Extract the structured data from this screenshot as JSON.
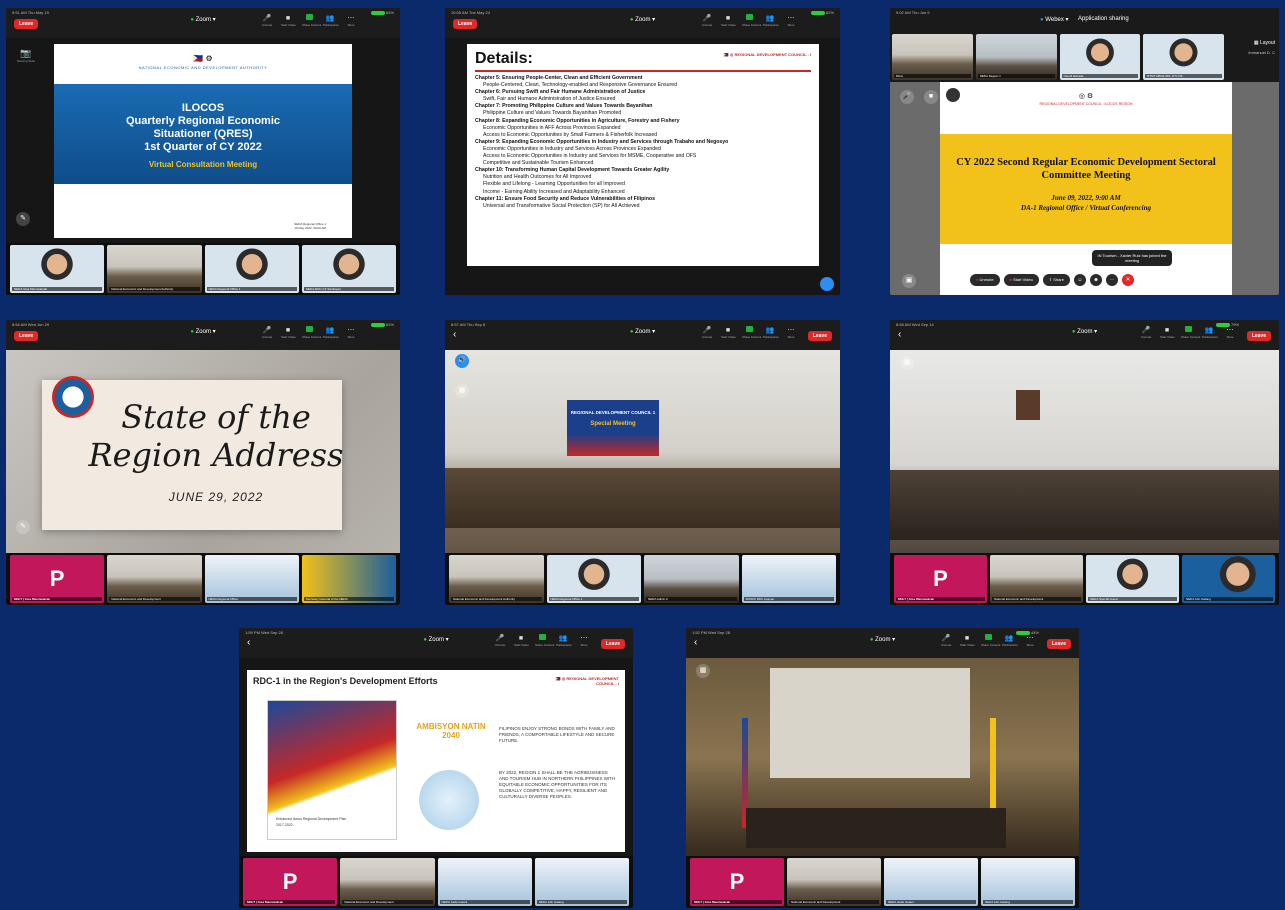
{
  "common": {
    "leave_label": "Leave",
    "zoom_title": "Zoom",
    "toolbar": [
      "Unmute",
      "Start Video",
      "Share Content",
      "Participants",
      "More"
    ]
  },
  "s1": {
    "time": "9:51 AM  Thu May 19",
    "battery": "64%",
    "photo_label": "Meeting Slide",
    "agency": "NATIONAL ECONOMIC AND DEVELOPMENT AUTHORITY",
    "title_lines": [
      "ILOCOS",
      "Quarterly Regional Economic",
      "Situationer (QRES)",
      "1st Quarter of CY 2022"
    ],
    "subtitle": "Virtual Consultation Meeting",
    "footer": [
      "NEDA Regional Office 1",
      "19 May 2022, 09:00 AM"
    ],
    "thumbs": [
      "NEDA Gisa Mannwakrab",
      "National Economic and Development Authority",
      "NEDA Regional Office 1",
      "NEDA-RDC-CF Santinyao"
    ]
  },
  "s2": {
    "time": "10:05 AM  Tue May 24",
    "battery": "62%",
    "heading": "Details:",
    "council": "REGIONAL DEVELOPMENT COUNCIL - I",
    "lines": [
      "Chapter 5: Ensuring People-Center, Clean and Efficient Government",
      "People-Centered, Clean, Technology-enabled and Responsive Governance Ensured",
      "Chapter 6: Pursuing Swift and Fair Humane Administration of Justice",
      "Swift, Fair and Humane Administration of Justice Ensured",
      "Chapter 7: Promoting Philippine Culture and Values Towards Bayanihan",
      "Philippine Culture and Values Towards Bayanihan Promoted",
      "Chapter 8: Expanding Economic Opportunities in Agriculture, Forestry and Fishery",
      "Economic Opportunities in AFF Across Provinces Expanded",
      "Access to Economic Opportunities by Small Farmers & Fisherfolk Increased",
      "Chapter 9: Expanding Economic Opportunities in Industry and Services through Trabaho and Negosyo",
      "Economic Opportunities in Industry and Services Across Provinces Expanded",
      "Access to Economic Opportunities in Industry and Services for MSME, Cooperative and OFS",
      "Competitive and Sustainable Tourism Enhanced",
      "Chapter 10: Transforming Human Capital Development Towards Greater Agility",
      "Nutrition and Health Outcomes for All Improved",
      "Flexible and Lifelong - Learning Opportunities for all Improved",
      "Income - Earning Ability Increased and Adaptability Enhanced",
      "Chapter 11: Ensure Food Security and Reduce Vulnerabilities of Filipinos",
      "Universal and Transformative Social Protection (SP) for All Achieved"
    ]
  },
  "s3": {
    "time": "9:02 AM  Thu Jun 9",
    "app": "Webex",
    "sharing": "Application sharing",
    "layout": "Layout",
    "people": [
      "DILG",
      "NEDA Region 1",
      "Cita M Estrada",
      "BTMT DBCE RPL DTI-VIS",
      "Immanuel D. C"
    ],
    "org_line": "REGIONAL DEVELOPMENT COUNCIL - ILOCOS REGION",
    "title": "CY 2022 Second Regular Economic Development Sectoral Committee Meeting",
    "date": "June 09, 2022, 9:00 AM",
    "venue": "DA-1 Regional Office / Virtual Conferencing",
    "toast": "IN Tourism - Xavier Ruiz has joined the meeting",
    "ctrl": [
      "Unmute",
      "Start Video",
      "Share"
    ]
  },
  "s4": {
    "time": "8:54 AM  Wed Jun 29",
    "battery": "61%",
    "title_lines": [
      "State of the",
      "Region Address"
    ],
    "date": "JUNE 29, 2022",
    "thumbs": [
      "MNLT | Gisa Mannwakrab",
      "National Economic and Development",
      "NEDA Regional Office",
      "Secretary General of the NEDA"
    ]
  },
  "s5": {
    "time": "8:57 AM  Thu Sep 8",
    "banner_title": "REGIONAL DEVELOPMENT COUNCIL 1",
    "banner_sub": "Special Meeting",
    "thumbs": [
      "National Economic and Development Authority",
      "NEDA Regional Office 1",
      "NEDA Admin 2",
      "SPRDC RDC Apayao"
    ]
  },
  "s6": {
    "time": "8:58 AM  Wed Sep 14",
    "battery": "79%",
    "thumbs": [
      "MNLT | Gisa Mannwakrab",
      "National Economic and Development",
      "NEDA Special Guest",
      "NEDA Lilin Galang"
    ]
  },
  "s7": {
    "time": "1:59 PM  Wed Sep 28",
    "battery": "80%",
    "heading": "RDC-1 in the Region's Development Efforts",
    "council": "REGIONAL DEVELOPMENT COUNCIL - I",
    "book_title": "Enhanced Ilocos Regional Development Plan",
    "book_years": "2017-2022",
    "ambisyon": "AMBISYON NATIN 2040",
    "para1": "FILIPINOS ENJOY STRONG BONDS WITH FAMILY AND FRIENDS, A COMFORTABLE LIFESTYLE AND SECURE FUTURE.",
    "para2": "BY 2022, REGION 1 SHALL BE THE AGRIBUSINESS AND TOURISM HUB IN NORTHERN PHILIPPINES WITH EQUITABLE ECONOMIC OPPORTUNITIES FOR ITS GLOBALLY COMPETITIVE, HAPPY, RESILIENT AND CULTURALLY DIVERSE PEOPLES.",
    "thumbs": [
      "MNLT | Gisa Mannwakrab",
      "National Economic and Development",
      "NEDA Judie Guiani",
      "NEDA Lilin Galang"
    ]
  },
  "s8": {
    "time": "1:52 PM  Wed Sep 28",
    "battery": "44%",
    "thumbs": [
      "MNLT | Gisa Mannwakrab",
      "National Economic and Development",
      "NEDA Judie Guiani",
      "NEDA Lilin Galang"
    ]
  },
  "colors": {
    "background": "#0b2a6b",
    "leave": "#e02828",
    "share_green": "#1fb141",
    "p_avatar": "#c2185b",
    "slide_yellow": "#f2c21b",
    "slide_blue": "#1b5f9e"
  }
}
